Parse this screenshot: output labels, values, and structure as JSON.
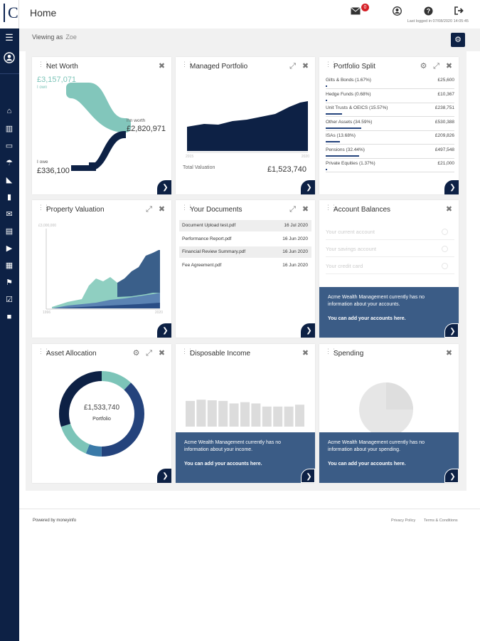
{
  "app": {
    "logo_letter": "C",
    "title": "Home",
    "last_logged": "Last logged in 07/08/2020 14:05:45"
  },
  "header": {
    "mail_badge": "0"
  },
  "subbar": {
    "viewing_label": "Viewing as",
    "viewing_user": "Zoe"
  },
  "net_worth": {
    "title": "Net Worth",
    "owns_value": "£3,157,071",
    "owns_label": "I own",
    "worth_label": "I'm worth",
    "worth_value": "£2,820,971",
    "owes_label": "I owe",
    "owes_value": "£336,100"
  },
  "managed_portfolio": {
    "title": "Managed Portfolio",
    "x_start": "2015",
    "x_end": "2020",
    "total_label": "Total Valuation",
    "total_value": "£1,523,740"
  },
  "portfolio_split": {
    "title": "Portfolio Split",
    "items": [
      {
        "label": "Gilts & Bonds (1.67%)",
        "value": "£25,600",
        "pct": 1.67
      },
      {
        "label": "Hedge Funds (0.68%)",
        "value": "£10,367",
        "pct": 0.68
      },
      {
        "label": "Unit Trusts & OEICS (15.57%)",
        "value": "£238,751",
        "pct": 15.57
      },
      {
        "label": "Other Assets (34.59%)",
        "value": "£530,388",
        "pct": 34.59
      },
      {
        "label": "ISAs (13.68%)",
        "value": "£209,826",
        "pct": 13.68
      },
      {
        "label": "Pensions (32.44%)",
        "value": "£497,548",
        "pct": 32.44
      },
      {
        "label": "Private Equities (1.37%)",
        "value": "£21,000",
        "pct": 1.37
      }
    ]
  },
  "property_valuation": {
    "title": "Property Valuation",
    "y_top": "£3,000,000",
    "x_start": "1996",
    "x_end": "2020"
  },
  "documents": {
    "title": "Your Documents",
    "rows": [
      {
        "name": "Document Upload test.pdf",
        "date": "16 Jul 2020"
      },
      {
        "name": "Performance Report.pdf",
        "date": "16 Jun 2020"
      },
      {
        "name": "Financial Review Summary.pdf",
        "date": "16 Jun 2020"
      },
      {
        "name": "Fee Agreement.pdf",
        "date": "16 Jun 2020"
      }
    ]
  },
  "account_balances": {
    "title": "Account Balances",
    "placeholders": [
      "Your current account",
      "Your savings account",
      "Your credit card"
    ],
    "message": "Acme Wealth Management currently has no information about your accounts.",
    "action": "You can add your accounts here."
  },
  "asset_allocation": {
    "title": "Asset Allocation",
    "center_value": "£1,533,740",
    "center_label": "Portfolio",
    "segments": [
      {
        "fraction": 0.12,
        "color": "#7cc4b8"
      },
      {
        "fraction": 0.38,
        "color": "#24437c"
      },
      {
        "fraction": 0.06,
        "color": "#3a7aa8"
      },
      {
        "fraction": 0.14,
        "color": "#7cc4b8"
      },
      {
        "fraction": 0.3,
        "color": "#0d2145"
      }
    ]
  },
  "disposable_income": {
    "title": "Disposable Income",
    "bars": [
      0.82,
      0.86,
      0.84,
      0.82,
      0.74,
      0.78,
      0.74,
      0.64,
      0.64,
      0.64,
      0.7
    ],
    "message": "Acme Wealth Management currently has no information about your income.",
    "action": "You can add your accounts here."
  },
  "spending": {
    "title": "Spending",
    "message": "Acme Wealth Management currently has no information about your spending.",
    "action": "You can add your accounts here."
  },
  "footer": {
    "powered": "Powered by moneyinfo",
    "privacy": "Privacy Policy",
    "terms": "Terms & Conditions"
  },
  "colors": {
    "navy": "#0d2145",
    "teal": "#7cc4b8",
    "panel": "#3b5c86",
    "badge": "#d51f26"
  }
}
